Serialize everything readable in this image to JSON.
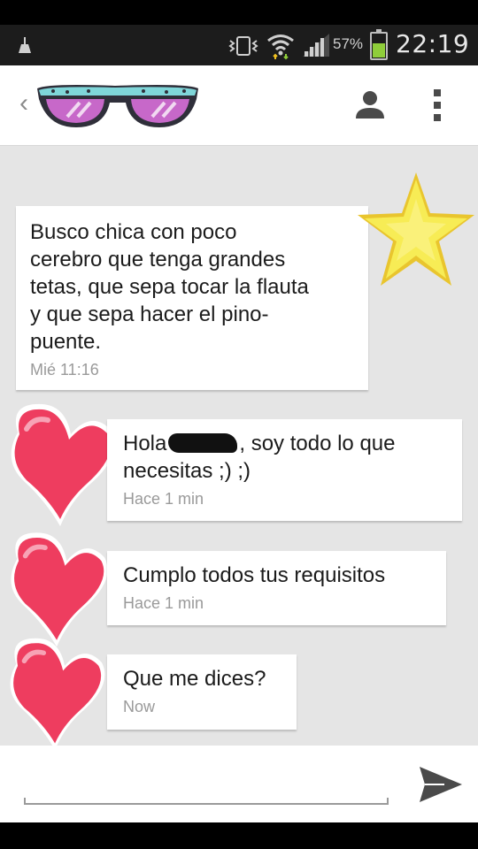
{
  "status_bar": {
    "battery_percent": "57%",
    "time": "22:19",
    "icons": [
      "cleaner-icon",
      "vibrate-icon",
      "wifi-icon",
      "signal-icon",
      "battery-icon"
    ],
    "battery_level": 0.57,
    "battery_color": "#8fcd3a"
  },
  "app_bar": {
    "avatar_icon": "sunglasses-avatar",
    "actions": [
      "person-icon",
      "overflow-menu-icon"
    ]
  },
  "messages": [
    {
      "sender": "contact",
      "text": "Busco chica con poco cerebro que tenga grandes tetas, que sepa tocar la flauta y que sepa hacer el pino-puente.",
      "lines": [
        "Busco chica con poco",
        "cerebro que tenga grandes",
        "tetas, que sepa tocar la flauta",
        "y que sepa hacer el pino-",
        "puente."
      ],
      "time": "Mié 11:16",
      "decoration": "star-icon"
    },
    {
      "sender": "me",
      "text_before": "Hola",
      "text_after": ", soy todo lo que",
      "line2": "necesitas ;) ;)",
      "time": "Hace 1 min",
      "decoration": "heart-icon"
    },
    {
      "sender": "me",
      "text": "Cumplo todos tus requisitos",
      "time": "Hace 1 min",
      "decoration": "heart-icon"
    },
    {
      "sender": "me",
      "text": "Que me dices?",
      "time": "Now",
      "decoration": "heart-icon"
    }
  ],
  "composer": {
    "input_value": "",
    "send_icon": "send-icon"
  },
  "colors": {
    "chat_background": "#e5e5e5",
    "bubble": "#ffffff",
    "heart": "#ee3d5f",
    "star": "#f4e23c"
  }
}
